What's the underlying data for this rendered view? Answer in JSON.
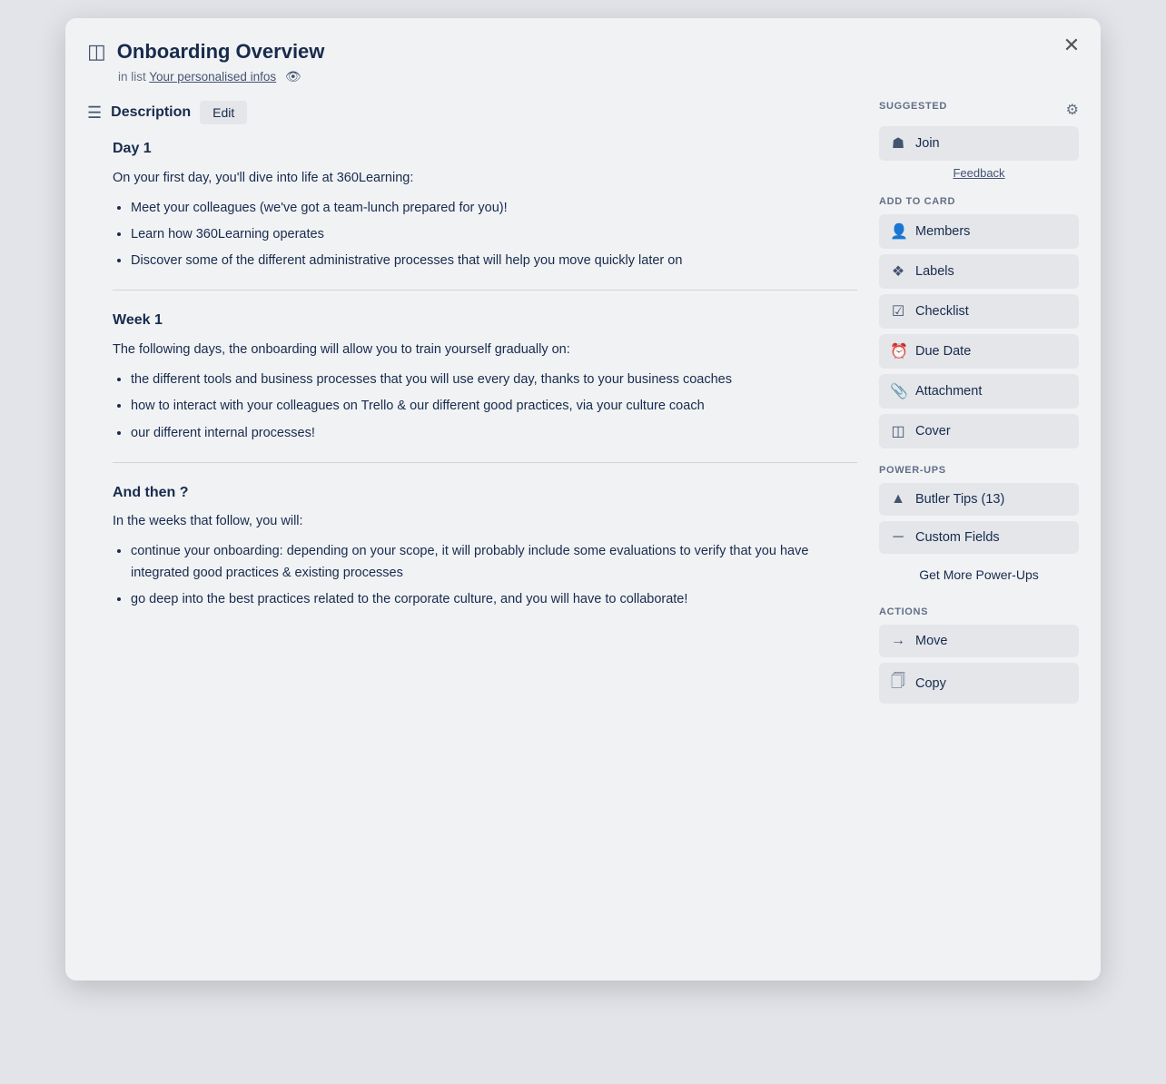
{
  "modal": {
    "title": "Onboarding Overview",
    "subtitle_prefix": "in list",
    "list_name": "Your personalised infos",
    "close_label": "✕"
  },
  "description": {
    "section_title": "Description",
    "edit_btn": "Edit",
    "sections": [
      {
        "heading": "Day 1",
        "intro": "On your first day, you'll dive into life at 360Learning:",
        "bullets": [
          "Meet your colleagues (we've got a team-lunch prepared for you)!",
          "Learn how 360Learning operates",
          "Discover some of the different administrative processes that will help you move quickly later on"
        ]
      },
      {
        "heading": "Week 1",
        "intro": "The following days, the onboarding will allow you to train yourself gradually on:",
        "bullets": [
          "the different tools and business processes that you will use every day, thanks to your business coaches",
          "how to interact with your colleagues on Trello & our different good practices, via your culture coach",
          "our different internal processes!"
        ]
      },
      {
        "heading": "And then ?",
        "intro": "In the weeks that follow, you will:",
        "bullets": [
          "continue your onboarding: depending on your scope, it will probably include some evaluations to verify that you have integrated good practices & existing processes",
          "go deep into the best practices related to the corporate culture, and you will have to collaborate!"
        ]
      }
    ]
  },
  "sidebar": {
    "suggested_label": "SUGGESTED",
    "add_to_card_label": "ADD TO CARD",
    "power_ups_label": "POWER-UPS",
    "actions_label": "ACTIONS",
    "join_label": "Join",
    "feedback_label": "Feedback",
    "members_label": "Members",
    "labels_label": "Labels",
    "checklist_label": "Checklist",
    "due_date_label": "Due Date",
    "attachment_label": "Attachment",
    "cover_label": "Cover",
    "butler_tips_label": "Butler Tips (13)",
    "custom_fields_label": "Custom Fields",
    "get_more_label": "Get More Power-Ups",
    "move_label": "Move",
    "copy_label": "Copy"
  }
}
